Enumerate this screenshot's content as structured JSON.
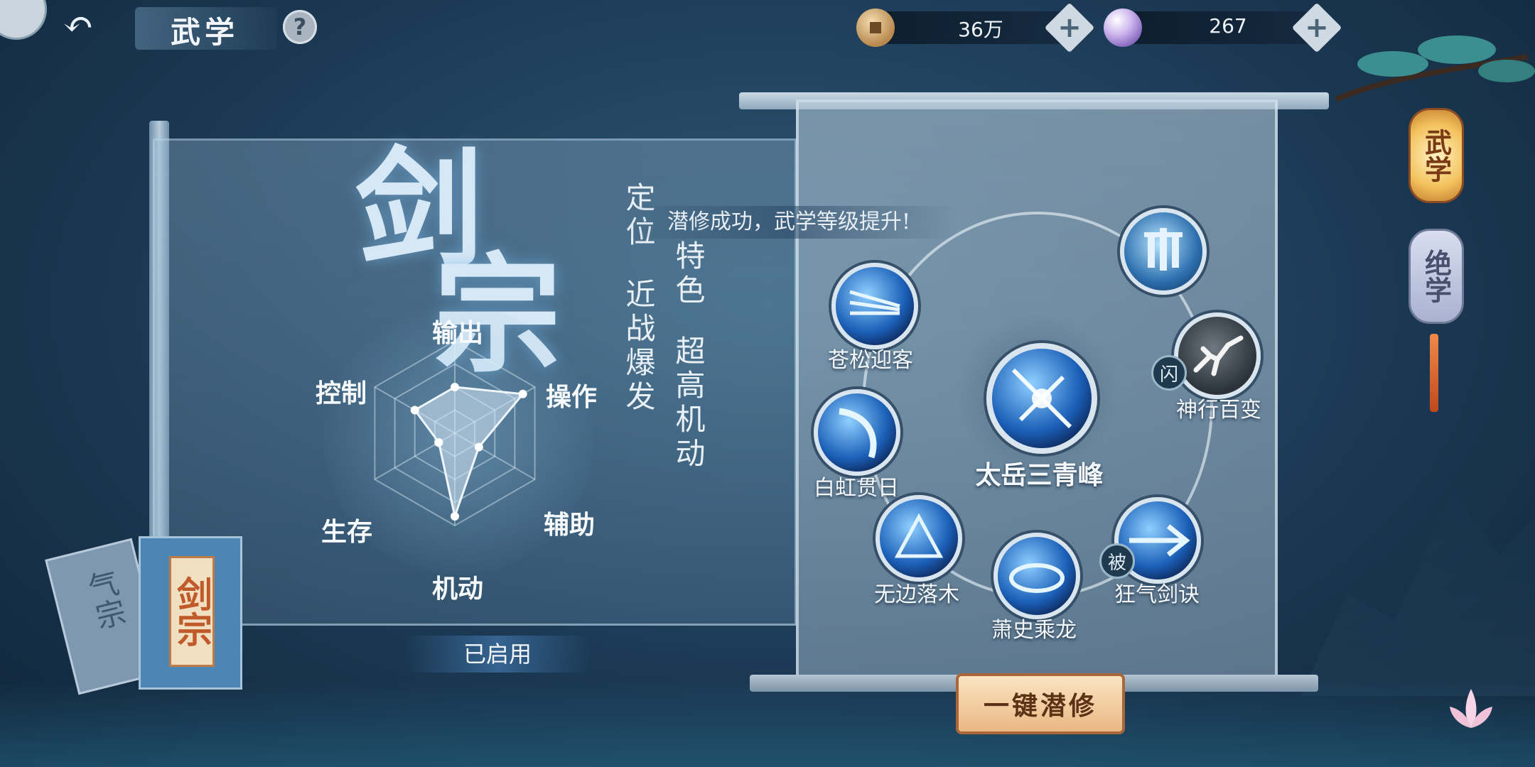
{
  "header": {
    "back_label": "返回",
    "title": "武学",
    "help_label": "?"
  },
  "currency": {
    "coins": "36万",
    "pearls": "267"
  },
  "left_panel": {
    "school_name": "剑宗",
    "positioning_label": "定位",
    "positioning_value": "近战爆发",
    "feature_label": "特色",
    "feature_value": "超高机动",
    "status": "已启用",
    "radar": {
      "labels": [
        "输出",
        "操作",
        "辅助",
        "机动",
        "生存",
        "控制"
      ],
      "values": [
        0.5,
        0.85,
        0.3,
        0.9,
        0.2,
        0.5
      ]
    },
    "books": [
      {
        "name": "气宗",
        "selected": false
      },
      {
        "name": "剑宗",
        "selected": true
      }
    ]
  },
  "right_panel": {
    "toast": "潜修成功，武学等级提升!",
    "center_skill": "太岳三青峰",
    "top_skill": "",
    "skills": [
      {
        "name": "苍松迎客"
      },
      {
        "name": "神行百变",
        "tag": "闪"
      },
      {
        "name": "白虹贯日"
      },
      {
        "name": "无边落木"
      },
      {
        "name": "萧史乘龙"
      },
      {
        "name": "狂气剑诀",
        "tag": "被"
      }
    ],
    "action_button": "一键潜修"
  },
  "side_tabs": [
    {
      "label": "武学",
      "active": true
    },
    {
      "label": "绝学",
      "active": false
    }
  ],
  "colors": {
    "background": "#1c3a55",
    "accent_gold": "#f3c25d",
    "action_button": "#e9b884",
    "radar_fill": "#cfe3f2"
  }
}
